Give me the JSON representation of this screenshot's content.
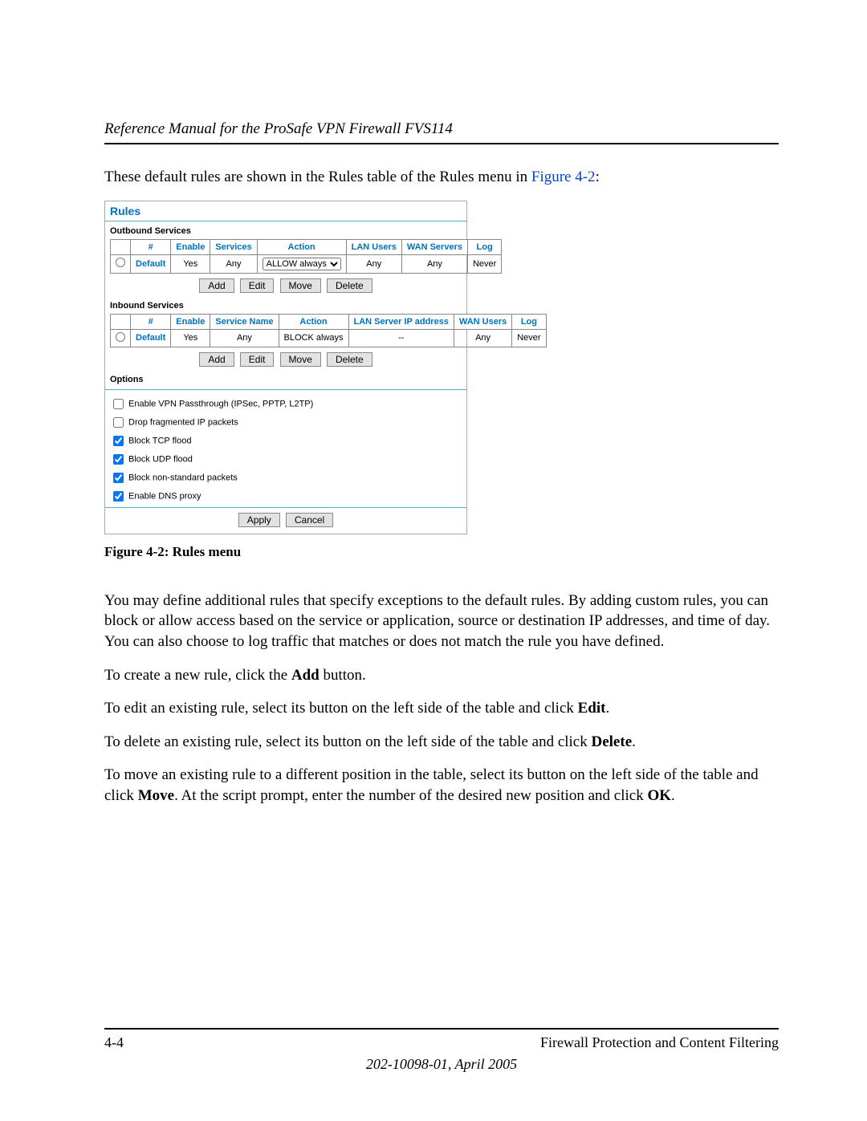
{
  "header": "Reference Manual for the ProSafe VPN Firewall FVS114",
  "intro_pre": "These default rules are shown in the Rules table of the Rules menu in ",
  "intro_link": "Figure 4-2",
  "intro_post": ":",
  "figcaption": "Figure 4-2:  Rules menu",
  "body1": "You may define additional rules that specify exceptions to the default rules. By adding custom rules, you can block or allow access based on the service or application, source or destination IP addresses, and time of day. You can also choose to log traffic that matches or does not match the rule you have defined.",
  "body_add_pre": "To create a new rule, click the ",
  "body_add_bold": "Add",
  "body_add_post": " button.",
  "body_edit_pre": "To edit an existing rule, select its button on the left side of the table and click ",
  "body_edit_bold": "Edit",
  "body_edit_post": ".",
  "body_delete_pre": "To delete an existing rule, select its button on the left side of the table and click ",
  "body_delete_bold": "Delete",
  "body_delete_post": ".",
  "body_move_pre": "To move an existing rule to a different position in the table, select its button on the left side of the table and click ",
  "body_move_bold": "Move",
  "body_move_mid": ". At the script prompt, enter the number of the desired new position and click ",
  "body_move_bold2": "OK",
  "body_move_post": ".",
  "footer_left": "4-4",
  "footer_right": "Firewall Protection and Content Filtering",
  "footer_docid": "202-10098-01, April 2005",
  "rules": {
    "title": "Rules",
    "outbound_label": "Outbound Services",
    "inbound_label": "Inbound Services",
    "options_label": "Options",
    "out_headers": [
      "#",
      "Enable",
      "Services",
      "Action",
      "LAN Users",
      "WAN Servers",
      "Log"
    ],
    "out_row": {
      "num": "Default",
      "enable": "Yes",
      "services": "Any",
      "action": "ALLOW always",
      "lan": "Any",
      "wan": "Any",
      "log": "Never"
    },
    "in_headers": [
      "#",
      "Enable",
      "Service Name",
      "Action",
      "LAN Server IP address",
      "WAN Users",
      "Log"
    ],
    "in_row": {
      "num": "Default",
      "enable": "Yes",
      "service": "Any",
      "action": "BLOCK always",
      "lanip": "--",
      "wan": "Any",
      "log": "Never"
    },
    "buttons": {
      "add": "Add",
      "edit": "Edit",
      "move": "Move",
      "delete": "Delete"
    },
    "options": [
      {
        "label": "Enable VPN Passthrough (IPSec, PPTP, L2TP)",
        "checked": false
      },
      {
        "label": "Drop fragmented IP packets",
        "checked": false
      },
      {
        "label": "Block TCP flood",
        "checked": true
      },
      {
        "label": "Block UDP flood",
        "checked": true
      },
      {
        "label": "Block non-standard packets",
        "checked": true
      },
      {
        "label": "Enable DNS proxy",
        "checked": true
      }
    ],
    "apply": "Apply",
    "cancel": "Cancel"
  }
}
